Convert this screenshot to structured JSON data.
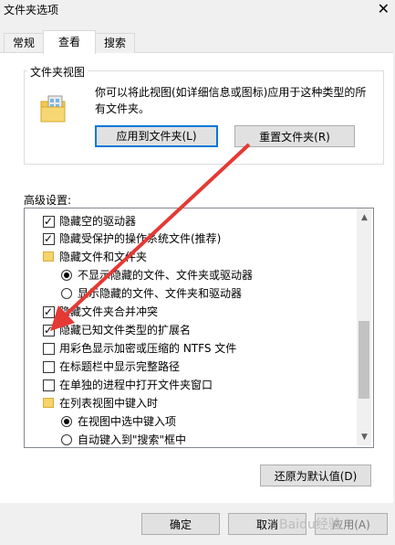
{
  "window": {
    "title": "文件夹选项",
    "close_glyph": "✕"
  },
  "tabs": [
    {
      "label": "常规",
      "active": false
    },
    {
      "label": "查看",
      "active": true
    },
    {
      "label": "搜索",
      "active": false
    }
  ],
  "folder_views": {
    "label": "文件夹视图",
    "description": "你可以将此视图(如详细信息或图标)应用于这种类型的所有文件夹。",
    "apply_button": "应用到文件夹(L)",
    "reset_button": "重置文件夹(R)"
  },
  "advanced": {
    "label": "高级设置:",
    "items": [
      {
        "type": "checkbox",
        "checked": true,
        "text": "隐藏空的驱动器"
      },
      {
        "type": "checkbox",
        "checked": true,
        "text": "隐藏受保护的操作系统文件(推荐)"
      },
      {
        "type": "folder",
        "text": "隐藏文件和文件夹"
      },
      {
        "type": "radio",
        "checked": true,
        "text": "不显示隐藏的文件、文件夹或驱动器"
      },
      {
        "type": "radio",
        "checked": false,
        "text": "显示隐藏的文件、文件夹和驱动器"
      },
      {
        "type": "checkbox",
        "checked": true,
        "text": "隐藏文件夹合并冲突"
      },
      {
        "type": "checkbox",
        "checked": true,
        "text": "隐藏已知文件类型的扩展名"
      },
      {
        "type": "checkbox",
        "checked": false,
        "text": "用彩色显示加密或压缩的 NTFS 文件"
      },
      {
        "type": "checkbox",
        "checked": false,
        "text": "在标题栏中显示完整路径"
      },
      {
        "type": "checkbox",
        "checked": false,
        "text": "在单独的进程中打开文件夹窗口"
      },
      {
        "type": "folder",
        "text": "在列表视图中键入时"
      },
      {
        "type": "radio",
        "checked": true,
        "text": "在视图中选中键入项"
      },
      {
        "type": "radio",
        "checked": false,
        "text": "自动键入到\"搜索\"框中"
      }
    ],
    "restore_button": "还原为默认值(D)"
  },
  "footer": {
    "ok_button": "确定",
    "cancel_button": "取消",
    "apply_button": "应用(A)"
  },
  "watermark": "Baidu经验",
  "colors": {
    "accent": "#0078d7",
    "annotation_arrow": "#e53935"
  },
  "icons": {
    "folder": "folder-icon",
    "scroll_up": "chevron-up-icon",
    "scroll_down": "chevron-down-icon"
  }
}
